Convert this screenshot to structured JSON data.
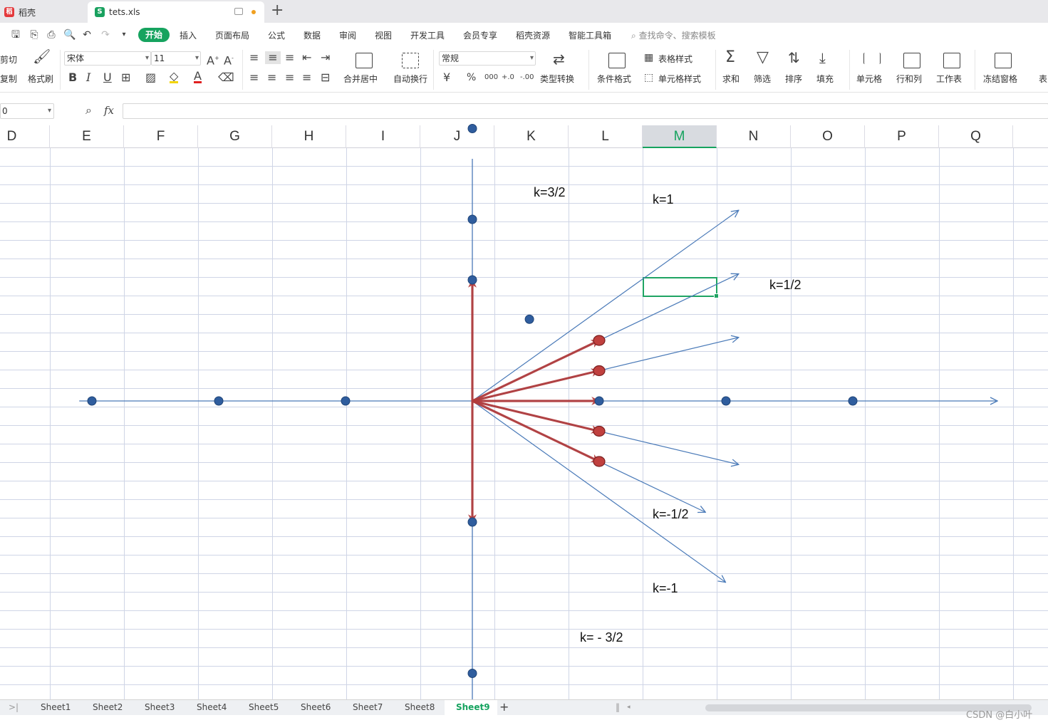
{
  "tabs": {
    "app_name": "稻壳",
    "file_name": "tets.xls",
    "new_tab": "+"
  },
  "menu": {
    "items": [
      "开始",
      "插入",
      "页面布局",
      "公式",
      "数据",
      "审阅",
      "视图",
      "开发工具",
      "会员专享",
      "稻壳资源",
      "智能工具箱"
    ],
    "search_placeholder": "查找命令、搜索模板"
  },
  "ribbon": {
    "cut": "剪切",
    "copy": "复制",
    "format_painter": "格式刷",
    "font_name": "宋体",
    "font_size": "11",
    "merge_center": "合并居中",
    "wrap_text": "自动换行",
    "number_format": "常规",
    "type_convert": "类型转换",
    "conditional_format": "条件格式",
    "table_style": "表格样式",
    "cell_style": "单元格样式",
    "sum": "求和",
    "filter": "筛选",
    "sort": "排序",
    "fill": "填充",
    "cell": "单元格",
    "row_col": "行和列",
    "worksheet": "工作表",
    "freeze": "冻结窗格",
    "table_tools": "表",
    "bold": "B",
    "italic": "I",
    "underline": "U",
    "currency": "¥",
    "percent": "%",
    "thousands": "000",
    "inc_decimal": "+.0",
    "dec_decimal": "-.00"
  },
  "formula_bar": {
    "name_box": "0",
    "fx": "fx",
    "value": ""
  },
  "columns": [
    "D",
    "E",
    "F",
    "G",
    "H",
    "I",
    "J",
    "K",
    "L",
    "M",
    "N",
    "O",
    "P",
    "Q"
  ],
  "selected_column": "M",
  "chart_data": {
    "type": "line",
    "title": "",
    "xlabel": "",
    "ylabel": "",
    "series": [
      {
        "label": "k=3/2",
        "slope": 1.5
      },
      {
        "label": "k=1",
        "slope": 1
      },
      {
        "label": "k=1/2",
        "slope": 0.5
      },
      {
        "label": "k=-1/2",
        "slope": -0.5
      },
      {
        "label": "k=-1",
        "slope": -1
      },
      {
        "label": "k= - 3/2",
        "slope": -1.5
      }
    ],
    "axis_points_x": [
      -3,
      -2,
      -1,
      1,
      2,
      3
    ],
    "axis_points_y": [
      4.5,
      3,
      2,
      -2,
      -4.5
    ],
    "highlighted_vectors": [
      [
        0,
        2
      ],
      [
        1,
        1
      ],
      [
        1,
        0.5
      ],
      [
        1,
        0
      ],
      [
        1,
        -0.5
      ],
      [
        1,
        -1
      ],
      [
        0,
        -2
      ]
    ]
  },
  "sheets": {
    "names": [
      "Sheet1",
      "Sheet2",
      "Sheet3",
      "Sheet4",
      "Sheet5",
      "Sheet6",
      "Sheet7",
      "Sheet8",
      "Sheet9"
    ],
    "active": "Sheet9",
    "add": "+"
  },
  "watermark": "CSDN @白小叶",
  "colors": {
    "accent": "#16a35f",
    "line": "#4a7ab8",
    "point": "#2f5d9e",
    "vector": "#b33a3a"
  }
}
